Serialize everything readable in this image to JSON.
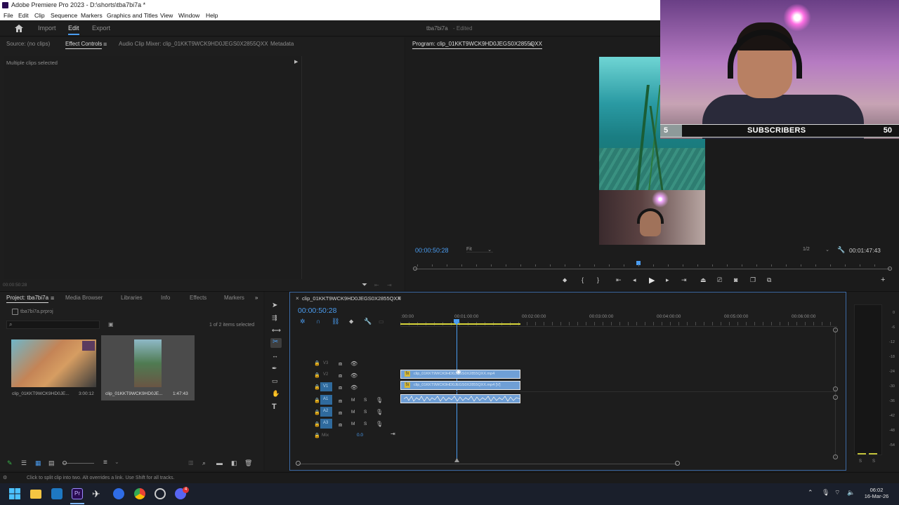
{
  "app": {
    "title": "Adobe Premiere Pro 2023 - D:\\shorts\\tba7bi7a *",
    "menu": [
      "File",
      "Edit",
      "Clip",
      "Sequence",
      "Markers",
      "Graphics and Titles",
      "View",
      "Window",
      "Help"
    ]
  },
  "workspace": {
    "tabs": [
      "Import",
      "Edit",
      "Export"
    ],
    "active": "Edit",
    "project_name": "tba7bi7a",
    "status": "- Edited"
  },
  "source_panel": {
    "tabs": [
      "Source: (no clips)",
      "Effect Controls",
      "Audio Clip Mixer: clip_01KKT9WCK9HD0JEGS0X2855QXX",
      "Metadata"
    ],
    "active": "Effect Controls",
    "message": "Multiple clips selected",
    "timecode": "00:00:50:28"
  },
  "program_monitor": {
    "title": "Program: clip_01KKT9WCK9HD0JEGS0X2855QXX",
    "timecode": "00:00:50:28",
    "fit": "Fit",
    "resolution": "1/2",
    "duration": "00:01:47:43",
    "playhead_fraction": 0.47
  },
  "webcam_overlay": {
    "count": "5",
    "label": "SUBSCRIBERS",
    "goal": "50",
    "progress_fraction": 0.1
  },
  "project_panel": {
    "tabs": [
      "Project: tba7bi7a",
      "Media Browser",
      "Libraries",
      "Info",
      "Effects",
      "Markers"
    ],
    "active": "Project: tba7bi7a",
    "file": "tba7bi7a.prproj",
    "selection_status": "1 of 2 items selected",
    "items": [
      {
        "name": "clip_01KKT9WCK9HD0JE...",
        "duration": "3:00:12"
      },
      {
        "name": "clip_01KKT9WCK9HD0JE...",
        "duration": "1:47:43"
      }
    ]
  },
  "timeline": {
    "sequence": "clip_01KKT9WCK9HD0JEGS0X2855QXX",
    "timecode": "00:00:50:28",
    "ruler": [
      ":00:00",
      "00:01:00:00",
      "00:02:00:00",
      "00:03:00:00",
      "00:04:00:00",
      "00:05:00:00",
      "00:06:00:00"
    ],
    "video_tracks": [
      "V3",
      "V2",
      "V1"
    ],
    "audio_tracks": [
      "A1",
      "A2",
      "A3"
    ],
    "mix_label": "Mix",
    "mix_value": "0.0",
    "clip_v2": "clip_01KKT9WCK9HD0JEGS0X2855QXX.mp4",
    "clip_v1": "clip_01KKT9WCK9HD0JEGS0X2855QXX.mp4 [V]",
    "m_label": "M",
    "s_label": "S"
  },
  "meter": {
    "scale": [
      "0",
      "-6",
      "-12",
      "-18",
      "-24",
      "-30",
      "-36",
      "-42",
      "-48",
      "-54"
    ],
    "solo": [
      "S",
      "S"
    ]
  },
  "status_bar": {
    "hint": "Click to split clip into two. Alt overrides a link. Use Shift for all tracks."
  },
  "taskbar": {
    "time": "06:02",
    "date": "16-Mar-26",
    "badge": "4"
  },
  "colors": {
    "accent": "#4a9cf0",
    "selection": "#2f6a9d",
    "clip": "#6f9fd6",
    "timeline_border": "#3d6aa5"
  }
}
